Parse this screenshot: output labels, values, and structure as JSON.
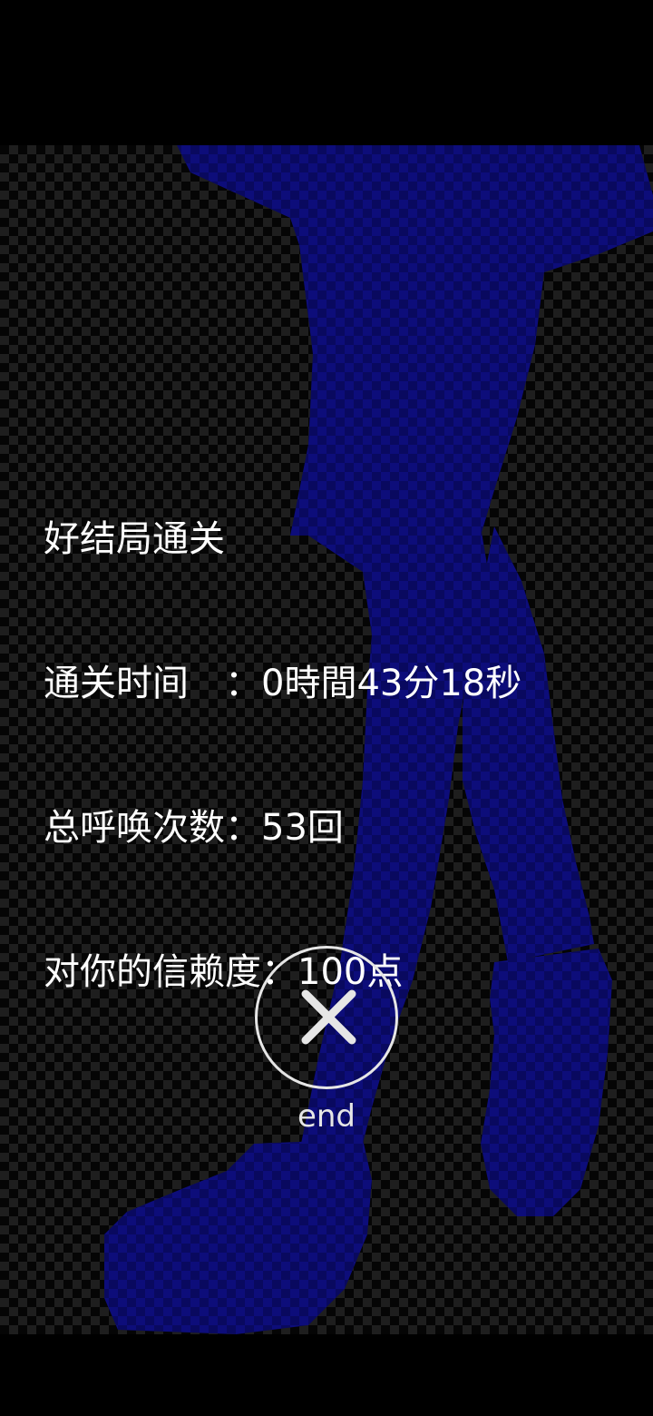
{
  "result": {
    "ending": "好结局通关",
    "clear_time": "通关时间　：0時間43分18秒",
    "total_calls": "总呼唤次数：53回",
    "trust": "对你的信赖度：100点"
  },
  "end_button": {
    "icon": "close-icon",
    "label": "end"
  },
  "colors": {
    "silhouette": "#0a0a6e",
    "checker_dark": "#050505",
    "checker_light": "#1e1e1e",
    "text": "#ffffff"
  }
}
